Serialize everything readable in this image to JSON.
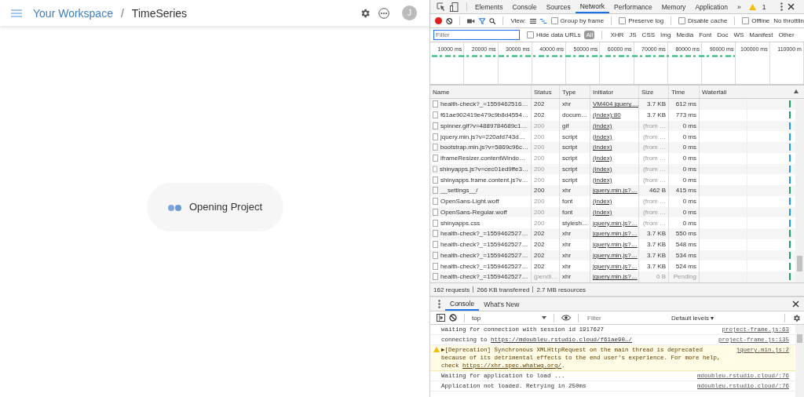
{
  "app_header": {
    "breadcrumb": [
      {
        "label": "Your Workspace",
        "kind": "link"
      },
      {
        "label": "TimeSeries",
        "kind": "current"
      }
    ],
    "separator": "/",
    "avatar_initial": "J"
  },
  "loading": {
    "text": "Opening Project"
  },
  "devtools": {
    "tabs": [
      {
        "label": "Elements",
        "selected": false
      },
      {
        "label": "Console",
        "selected": false
      },
      {
        "label": "Sources",
        "selected": false
      },
      {
        "label": "Network",
        "selected": true
      },
      {
        "label": "Performance",
        "selected": false
      },
      {
        "label": "Memory",
        "selected": false
      },
      {
        "label": "Application",
        "selected": false
      }
    ],
    "overflow": "»",
    "warning_count": "1",
    "toolbar": {
      "recording": true,
      "view_label": "View:",
      "options": [
        {
          "label": "Group by frame",
          "checked": false
        },
        {
          "label": "Preserve log",
          "checked": false
        },
        {
          "label": "Disable cache",
          "checked": false
        },
        {
          "label": "Offline",
          "checked": false
        }
      ],
      "throttling": "No throttlin"
    },
    "filter": {
      "placeholder": "Filter",
      "hide_data_urls": {
        "label": "Hide data URLs",
        "checked": false
      },
      "types": [
        {
          "label": "All",
          "selected": true
        },
        {
          "label": "XHR",
          "selected": false
        },
        {
          "label": "JS",
          "selected": false
        },
        {
          "label": "CSS",
          "selected": false
        },
        {
          "label": "Img",
          "selected": false
        },
        {
          "label": "Media",
          "selected": false
        },
        {
          "label": "Font",
          "selected": false
        },
        {
          "label": "Doc",
          "selected": false
        },
        {
          "label": "WS",
          "selected": false
        },
        {
          "label": "Manifest",
          "selected": false
        },
        {
          "label": "Other",
          "selected": false
        }
      ]
    },
    "timeline_ticks": [
      "10000 ms",
      "20000 ms",
      "30000 ms",
      "40000 ms",
      "50000 ms",
      "60000 ms",
      "70000 ms",
      "80000 ms",
      "90000 ms",
      "100000 ms",
      "110000 m"
    ],
    "table": {
      "columns": [
        "Name",
        "Status",
        "Type",
        "Initiator",
        "Size",
        "Time",
        "Waterfall"
      ],
      "rows": [
        {
          "name": "health-check?_=1559462516…",
          "status": "202",
          "type": "xhr",
          "initiator": "VM404 jquery.…",
          "size": "3.7 KB",
          "time": "612 ms",
          "cached": false,
          "color": "#1aa260"
        },
        {
          "name": "f61ae902419e479c9b8d4554…",
          "status": "202",
          "type": "docum…",
          "initiator": "(index):80",
          "size": "3.7 KB",
          "time": "773 ms",
          "cached": false,
          "color": "#1aa260"
        },
        {
          "name": "spinner.gif?v=4889784689c1…",
          "status": "200",
          "type": "gif",
          "initiator": "(index)",
          "size": "(from …",
          "time": "0 ms",
          "cached": true,
          "color": "#1a9de0"
        },
        {
          "name": "jquery.min.js?v=220afd743d…",
          "status": "200",
          "type": "script",
          "initiator": "(index)",
          "size": "(from …",
          "time": "0 ms",
          "cached": true,
          "color": "#1a9de0"
        },
        {
          "name": "bootstrap.min.js?v=5869c96c…",
          "status": "200",
          "type": "script",
          "initiator": "(index)",
          "size": "(from …",
          "time": "0 ms",
          "cached": true,
          "color": "#1a9de0"
        },
        {
          "name": "iframeResizer.contentWindo…",
          "status": "200",
          "type": "script",
          "initiator": "(index)",
          "size": "(from …",
          "time": "0 ms",
          "cached": true,
          "color": "#1a9de0"
        },
        {
          "name": "shinyapps.js?v=cec01ed9ffe3…",
          "status": "200",
          "type": "script",
          "initiator": "(index)",
          "size": "(from …",
          "time": "0 ms",
          "cached": true,
          "color": "#1a9de0"
        },
        {
          "name": "shinyapps.frame.content.js?v…",
          "status": "200",
          "type": "script",
          "initiator": "(index)",
          "size": "(from …",
          "time": "0 ms",
          "cached": true,
          "color": "#1a9de0"
        },
        {
          "name": "__settings__/",
          "status": "200",
          "type": "xhr",
          "initiator": "jquery.min.js?…",
          "size": "462 B",
          "time": "415 ms",
          "cached": false,
          "color": "#1aa260"
        },
        {
          "name": "OpenSans-Light.woff",
          "status": "200",
          "type": "font",
          "initiator": "(index)",
          "size": "(from …",
          "time": "0 ms",
          "cached": true,
          "color": "#1a9de0"
        },
        {
          "name": "OpenSans-Regular.woff",
          "status": "200",
          "type": "font",
          "initiator": "(index)",
          "size": "(from …",
          "time": "0 ms",
          "cached": true,
          "color": "#1a9de0"
        },
        {
          "name": "shinyapps.css",
          "status": "200",
          "type": "stylesh…",
          "initiator": "jquery.min.js?…",
          "size": "(from …",
          "time": "0 ms",
          "cached": true,
          "color": "#1a9de0"
        },
        {
          "name": "health-check?_=1559462527…",
          "status": "202",
          "type": "xhr",
          "initiator": "jquery.min.js?…",
          "size": "3.7 KB",
          "time": "550 ms",
          "cached": false,
          "color": "#1aa260"
        },
        {
          "name": "health-check?_=1559462527…",
          "status": "202",
          "type": "xhr",
          "initiator": "jquery.min.js?…",
          "size": "3.7 KB",
          "time": "548 ms",
          "cached": false,
          "color": "#1aa260"
        },
        {
          "name": "health-check?_=1559462527…",
          "status": "202",
          "type": "xhr",
          "initiator": "jquery.min.js?…",
          "size": "3.7 KB",
          "time": "534 ms",
          "cached": false,
          "color": "#1aa260"
        },
        {
          "name": "health-check?_=1559462527…",
          "status": "202",
          "type": "xhr",
          "initiator": "jquery.min.js?…",
          "size": "3.7 KB",
          "time": "524 ms",
          "cached": false,
          "color": "#1aa260"
        },
        {
          "name": "health-check?_=1559462527…",
          "status": "(pendi…",
          "type": "xhr",
          "initiator": "jquery.min.js?…",
          "size": "0 B",
          "time": "Pending",
          "cached": true,
          "color": "#1aa260"
        }
      ]
    },
    "summary": [
      "162 requests",
      "266 KB transferred",
      "2.7 MB resources"
    ],
    "drawer": {
      "tabs": [
        {
          "label": "Console",
          "selected": true
        },
        {
          "label": "What's New",
          "selected": false
        }
      ],
      "context": "top",
      "filter_placeholder": "Filter",
      "levels": "Default levels ▾",
      "messages": [
        {
          "kind": "log",
          "parts": [
            {
              "text": "waiting for connection with session id 1917627"
            }
          ],
          "source": "project-frame.js:63"
        },
        {
          "kind": "log",
          "parts": [
            {
              "text": "connecting to "
            },
            {
              "text": "https://mdoubleu.rstudio.cloud/f61ae90…/",
              "link": true
            }
          ],
          "source": "project-frame.js:135"
        },
        {
          "kind": "warning",
          "parts": [
            {
              "text": "▶[Deprecation] Synchronous XMLHttpRequest on the main thread is deprecated because of its detrimental effects to the end user's experience. For more help, check "
            },
            {
              "text": "https://xhr.spec.whatwg.org/",
              "link": true
            },
            {
              "text": "."
            }
          ],
          "source": "jquery.min.js:2"
        },
        {
          "kind": "log",
          "parts": [
            {
              "text": "Waiting for application to load ..."
            }
          ],
          "source": "mdoubleu.rstudio.cloud/:76"
        },
        {
          "kind": "log",
          "parts": [
            {
              "text": "Application not loaded. Retrying in 250ms"
            }
          ],
          "source": "mdoubleu.rstudio.cloud/:76"
        }
      ]
    }
  }
}
